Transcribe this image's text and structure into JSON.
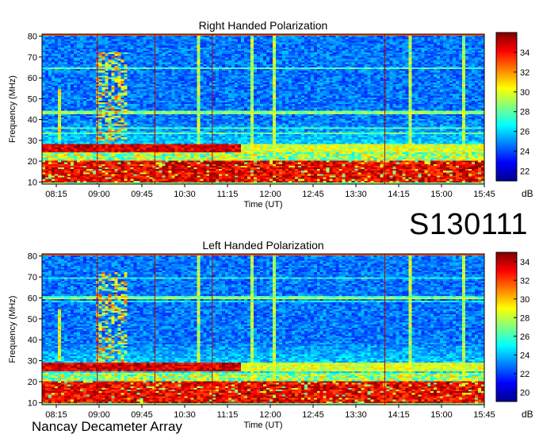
{
  "observation_id": "S130111",
  "instrument_label": "Nancay Decameter Array",
  "chart_data": [
    {
      "type": "heatmap",
      "title": "Right Handed Polarization",
      "xlabel": "Time (UT)",
      "ylabel": "Frequency (MHz)",
      "x_tick_labels": [
        "08:15",
        "09:00",
        "09:45",
        "10:30",
        "11:15",
        "12:00",
        "12:45",
        "13:30",
        "14:15",
        "15:00",
        "15:45"
      ],
      "x_range": [
        "08:00",
        "15:45"
      ],
      "y_ticks": [
        10,
        20,
        30,
        40,
        50,
        60,
        70,
        80
      ],
      "ylim": [
        9,
        81
      ],
      "colorbar": {
        "label": "dB",
        "ticks": [
          22,
          24,
          26,
          28,
          30,
          32,
          34
        ],
        "range": [
          21,
          36
        ]
      },
      "colormap": [
        "#00008f",
        "#0000ff",
        "#0080ff",
        "#00ffff",
        "#80ff80",
        "#ffff00",
        "#ff8000",
        "#ff0000",
        "#800000"
      ],
      "grid": false,
      "strong_bands_mhz": [
        [
          10,
          20
        ],
        [
          24,
          28
        ]
      ]
    },
    {
      "type": "heatmap",
      "title": "Left Handed Polarization",
      "xlabel": "Time (UT)",
      "ylabel": "Frequency (MHz)",
      "x_tick_labels": [
        "08:15",
        "09:00",
        "09:45",
        "10:30",
        "11:15",
        "12:00",
        "12:45",
        "13:30",
        "14:15",
        "15:00",
        "15:45"
      ],
      "x_range": [
        "08:00",
        "15:45"
      ],
      "y_ticks": [
        10,
        20,
        30,
        40,
        50,
        60,
        70,
        80
      ],
      "ylim": [
        9,
        81
      ],
      "colorbar": {
        "label": "dB",
        "ticks": [
          20,
          22,
          24,
          26,
          28,
          30,
          32,
          34
        ],
        "range": [
          19,
          35
        ]
      },
      "colormap": [
        "#00008f",
        "#0000ff",
        "#0080ff",
        "#00ffff",
        "#80ff80",
        "#ffff00",
        "#ff8000",
        "#ff0000",
        "#800000"
      ],
      "grid": false,
      "strong_bands_mhz": [
        [
          10,
          20
        ],
        [
          25,
          29
        ]
      ]
    }
  ]
}
